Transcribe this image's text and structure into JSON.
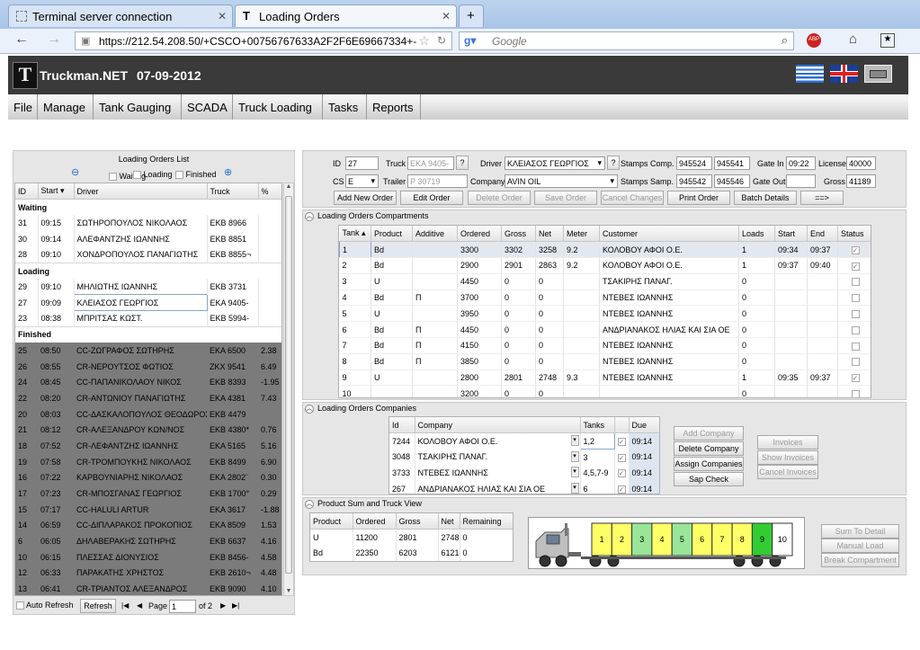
{
  "browser": {
    "tabs": [
      {
        "label": "Terminal server connection"
      },
      {
        "label": "Loading Orders"
      }
    ],
    "url": "https://212.54.208.50/+CSCO+00756767633A2F2F6E69667334+-",
    "search_placeholder": "Google"
  },
  "app": {
    "title": "Truckman.NET",
    "date": "07-09-2012"
  },
  "menu": [
    "File",
    "Manage",
    "Tank Gauging",
    "SCADA",
    "Truck Loading",
    "Tasks",
    "Reports"
  ],
  "left": {
    "title": "Loading Orders List",
    "filters": [
      "Waiting",
      "Loading",
      "Finished"
    ],
    "columns": [
      "ID",
      "Start",
      "Driver",
      "Truck",
      "%"
    ],
    "groups": [
      {
        "name": "Waiting",
        "rows": [
          [
            "31",
            "09:15",
            "ΣΩΤΗΡΟΠΟΥΛΟΣ ΝΙΚΟΛΑΟΣ",
            "ΕΚΒ 8966",
            ""
          ],
          [
            "30",
            "09:14",
            "ΑΛΕΦΑΝΤΖΗΣ ΙΩΑΝΝΗΣ",
            "ΕΚΒ 8851",
            ""
          ],
          [
            "28",
            "09:10",
            "ΧΟΝΔΡΟΠΟΥΛΟΣ ΠΑΝΑΓΙΩΤΗΣ",
            "ΕΚΒ 8855¬",
            ""
          ]
        ]
      },
      {
        "name": "Loading",
        "rows": [
          [
            "29",
            "09:10",
            "ΜΗΛΙΩΤΗΣ ΙΩΑΝΝΗΣ",
            "ΕΚΒ 3731",
            ""
          ],
          [
            "27",
            "09:09",
            "ΚΛΕΙΑΣΟΣ ΓΕΩΡΓΙΟΣ",
            "ΕΚΑ 9405-",
            ""
          ],
          [
            "23",
            "08:38",
            "ΜΠΡΙΤΣΑΣ ΚΩΣΤ.",
            "ΕΚΒ 5994-",
            ""
          ]
        ]
      },
      {
        "name": "Finished",
        "rows": [
          [
            "25",
            "08:50",
            "CC-ΖΩΓΡΑΦΟΣ ΣΩΤΗΡΗΣ",
            "ΕΚΑ 6500",
            "2.38"
          ],
          [
            "26",
            "08:55",
            "CR-ΝΕΡΟΥΤΣΟΣ ΦΩΤΙΟΣ",
            "ΖΚΧ 9541",
            "6.49"
          ],
          [
            "24",
            "08:45",
            "CC-ΠΑΠΑΝΙΚΟΛΑΟΥ ΝΙΚΟΣ",
            "ΕΚΒ 8393",
            "-1.95"
          ],
          [
            "22",
            "08:20",
            "CR-ΑΝΤΩΝΙΟΥ ΠΑΝΑΓΙΩΤΗΣ",
            "ΕΚΑ 4381",
            "7.43"
          ],
          [
            "20",
            "08:03",
            "CC-ΔΑΣΚΑΛΟΠΟΥΛΟΣ ΘΕΟΔΩΡΟΣ",
            "ΕΚΒ 4479",
            ""
          ],
          [
            "21",
            "08:12",
            "CR-ΑΛΕΞΑΝΔΡΟΥ ΚΩΝ/ΝΟΣ",
            "ΕΚΒ 4380*",
            "0.76"
          ],
          [
            "18",
            "07:52",
            "CR-ΛΕΦΑΝΤΖΗΣ ΙΩΑΝΝΗΣ",
            "ΕΚΑ 5165",
            "5.16"
          ],
          [
            "19",
            "07:58",
            "CR-ΤΡΟΜΠΟΥΚΗΣ ΝΙΚΟΛΑΟΣ",
            "ΕΚΒ 8499",
            "6.90"
          ],
          [
            "16",
            "07:22",
            "ΚΑΡΒΟΥΝΙΑΡΗΣ ΝΙΚΟΛΑΟΣ",
            "ΕΚΑ 2802¨",
            "0.30"
          ],
          [
            "17",
            "07:23",
            "CR-ΜΠΟΣΓΑΝΑΣ ΓΕΩΡΓΙΟΣ",
            "ΕΚΒ 1700°",
            "0.29"
          ],
          [
            "15",
            "07:17",
            "CC-HALULI ARTUR",
            "ΕΚΑ 3617",
            "-1.88"
          ],
          [
            "14",
            "06:59",
            "CC-ΔΙΠΛΑΡΑΚΟΣ ΠΡΟΚΟΠΙΟΣ",
            "ΕΚΑ 8509",
            "1.53"
          ],
          [
            "6",
            "06:05",
            "ΔΗΛΑΒΕΡΑΚΗΣ ΣΩΤΗΡΗΣ",
            "ΕΚΒ 6637",
            "4.16"
          ],
          [
            "10",
            "06:15",
            "ΠΛΕΣΣΑΣ ΔΙΟΝΥΣΙΟΣ",
            "ΕΚΒ 8456-",
            "4.58"
          ],
          [
            "12",
            "06:33",
            "ΠΑΡΑΚΑΤΗΣ ΧΡΗΣΤΟΣ",
            "ΕΚΒ 2610¬",
            "4.48"
          ],
          [
            "13",
            "06:41",
            "CR-ΤΡΙΑΝΤΟΣ ΑΛΕΞΑΝΔΡΟΣ",
            "ΕΚΒ 9090",
            "4.10"
          ]
        ]
      }
    ],
    "auto_refresh": "Auto Refresh",
    "refresh": "Refresh",
    "pager": {
      "label": "Page",
      "page": "1",
      "of": "of 2"
    }
  },
  "form": {
    "id_label": "ID",
    "id": "27",
    "truck_label": "Truck",
    "truck": "ΕΚΑ 9405-",
    "driver_label": "Driver",
    "driver": "ΚΛΕΙΑΣΟΣ ΓΕΩΡΓΙΟΣ",
    "stamps_comp_label": "Stamps Comp.",
    "stamps_comp": [
      "945524",
      "945541"
    ],
    "gate_in_label": "Gate In",
    "gate_in": "09:22",
    "license_label": "License",
    "license": "40000",
    "cs_label": "CS",
    "cs": "E",
    "trailer_label": "Trailer",
    "trailer": "P 30719",
    "company_label": "Company",
    "company": "AVIN OIL",
    "stamps_samp_label": "Stamps Samp.",
    "stamps_samp": [
      "945542",
      "945546"
    ],
    "gate_out_label": "Gate Out",
    "gate_out": "",
    "gross_label": "Gross",
    "gross": "41189",
    "q": "?",
    "buttons": [
      "Add New Order",
      "Edit Order",
      "Delete Order",
      "Save Order",
      "Cancel Changes",
      "Print Order",
      "Batch Details",
      "==>"
    ]
  },
  "compartments": {
    "title": "Loading Orders Compartments",
    "columns": [
      "Tank",
      "Product",
      "Additive",
      "Ordered",
      "Gross",
      "Net",
      "Meter",
      "Customer",
      "Loads",
      "Start",
      "End",
      "Status"
    ],
    "rows": [
      [
        "1",
        "Bd",
        "",
        "3300",
        "3302",
        "3258",
        "9.2",
        "ΚΟΛΟΒΟΥ ΑΦΟΙ Ο.Ε.",
        "1",
        "09:34",
        "09:37",
        "✓"
      ],
      [
        "2",
        "Bd",
        "",
        "2900",
        "2901",
        "2863",
        "9.2",
        "ΚΟΛΟΒΟΥ ΑΦΟΙ Ο.Ε.",
        "1",
        "09:37",
        "09:40",
        "✓"
      ],
      [
        "3",
        "U",
        "",
        "4450",
        "0",
        "0",
        "",
        "ΤΣΑΚΙΡΗΣ ΠΑΝΑΓ.",
        "0",
        "",
        "",
        ""
      ],
      [
        "4",
        "Bd",
        "Π",
        "3700",
        "0",
        "0",
        "",
        "ΝΤΕΒΕΣ ΙΩΑΝΝΗΣ",
        "0",
        "",
        "",
        ""
      ],
      [
        "5",
        "U",
        "",
        "3950",
        "0",
        "0",
        "",
        "ΝΤΕΒΕΣ ΙΩΑΝΝΗΣ",
        "0",
        "",
        "",
        ""
      ],
      [
        "6",
        "Bd",
        "Π",
        "4450",
        "0",
        "0",
        "",
        "ΑΝΔΡΙΑΝΑΚΟΣ ΗΛΙΑΣ ΚΑΙ ΣΙΑ ΟΕ",
        "0",
        "",
        "",
        ""
      ],
      [
        "7",
        "Bd",
        "Π",
        "4150",
        "0",
        "0",
        "",
        "ΝΤΕΒΕΣ ΙΩΑΝΝΗΣ",
        "0",
        "",
        "",
        ""
      ],
      [
        "8",
        "Bd",
        "Π",
        "3850",
        "0",
        "0",
        "",
        "ΝΤΕΒΕΣ ΙΩΑΝΝΗΣ",
        "0",
        "",
        "",
        ""
      ],
      [
        "9",
        "U",
        "",
        "2800",
        "2801",
        "2748",
        "9.3",
        "ΝΤΕΒΕΣ ΙΩΑΝΝΗΣ",
        "1",
        "09:35",
        "09:37",
        "✓"
      ],
      [
        "10",
        "",
        "",
        "3200",
        "0",
        "0",
        "",
        "",
        "0",
        "",
        "",
        ""
      ]
    ]
  },
  "companies": {
    "title": "Loading Orders Companies",
    "columns": [
      "Id",
      "Company",
      "Tanks",
      "Due"
    ],
    "rows": [
      [
        "7244",
        "ΚΟΛΟΒΟΥ ΑΦΟΙ Ο.Ε.",
        "1,2",
        "09:14"
      ],
      [
        "3048",
        "ΤΣΑΚΙΡΗΣ ΠΑΝΑΓ.",
        "3",
        "09:14"
      ],
      [
        "3733",
        "ΝΤΕΒΕΣ ΙΩΑΝΝΗΣ",
        "4,5,7-9",
        "09:14"
      ],
      [
        "267",
        "ΑΝΔΡΙΑΝΑΚΟΣ ΗΛΙΑΣ ΚΑΙ ΣΙΑ ΟΕ",
        "6",
        "09:14"
      ]
    ],
    "buttons": [
      "Add Company",
      "Delete Company",
      "Assign Companies",
      "Sap Check"
    ],
    "invoice_buttons": [
      "Invoices",
      "Show Invoices",
      "Cancel Invoices"
    ]
  },
  "sum": {
    "title": "Product Sum and Truck View",
    "columns": [
      "Product",
      "Ordered",
      "Gross",
      "Net",
      "Remaining"
    ],
    "rows": [
      [
        "U",
        "11200",
        "2801",
        "2748",
        "0"
      ],
      [
        "Bd",
        "22350",
        "6203",
        "6121",
        "0"
      ]
    ],
    "tanks": [
      "1",
      "2",
      "3",
      "4",
      "5",
      "6",
      "7",
      "8",
      "9",
      "10"
    ],
    "tank_colors": [
      "#ffff66",
      "#ffff66",
      "#99e699",
      "#ffff66",
      "#99e699",
      "#ffff66",
      "#ffff66",
      "#ffff66",
      "#33cc33",
      "#ffffff"
    ],
    "buttons": [
      "Sum To Detail",
      "Manual Load",
      "Break Compartment"
    ]
  }
}
